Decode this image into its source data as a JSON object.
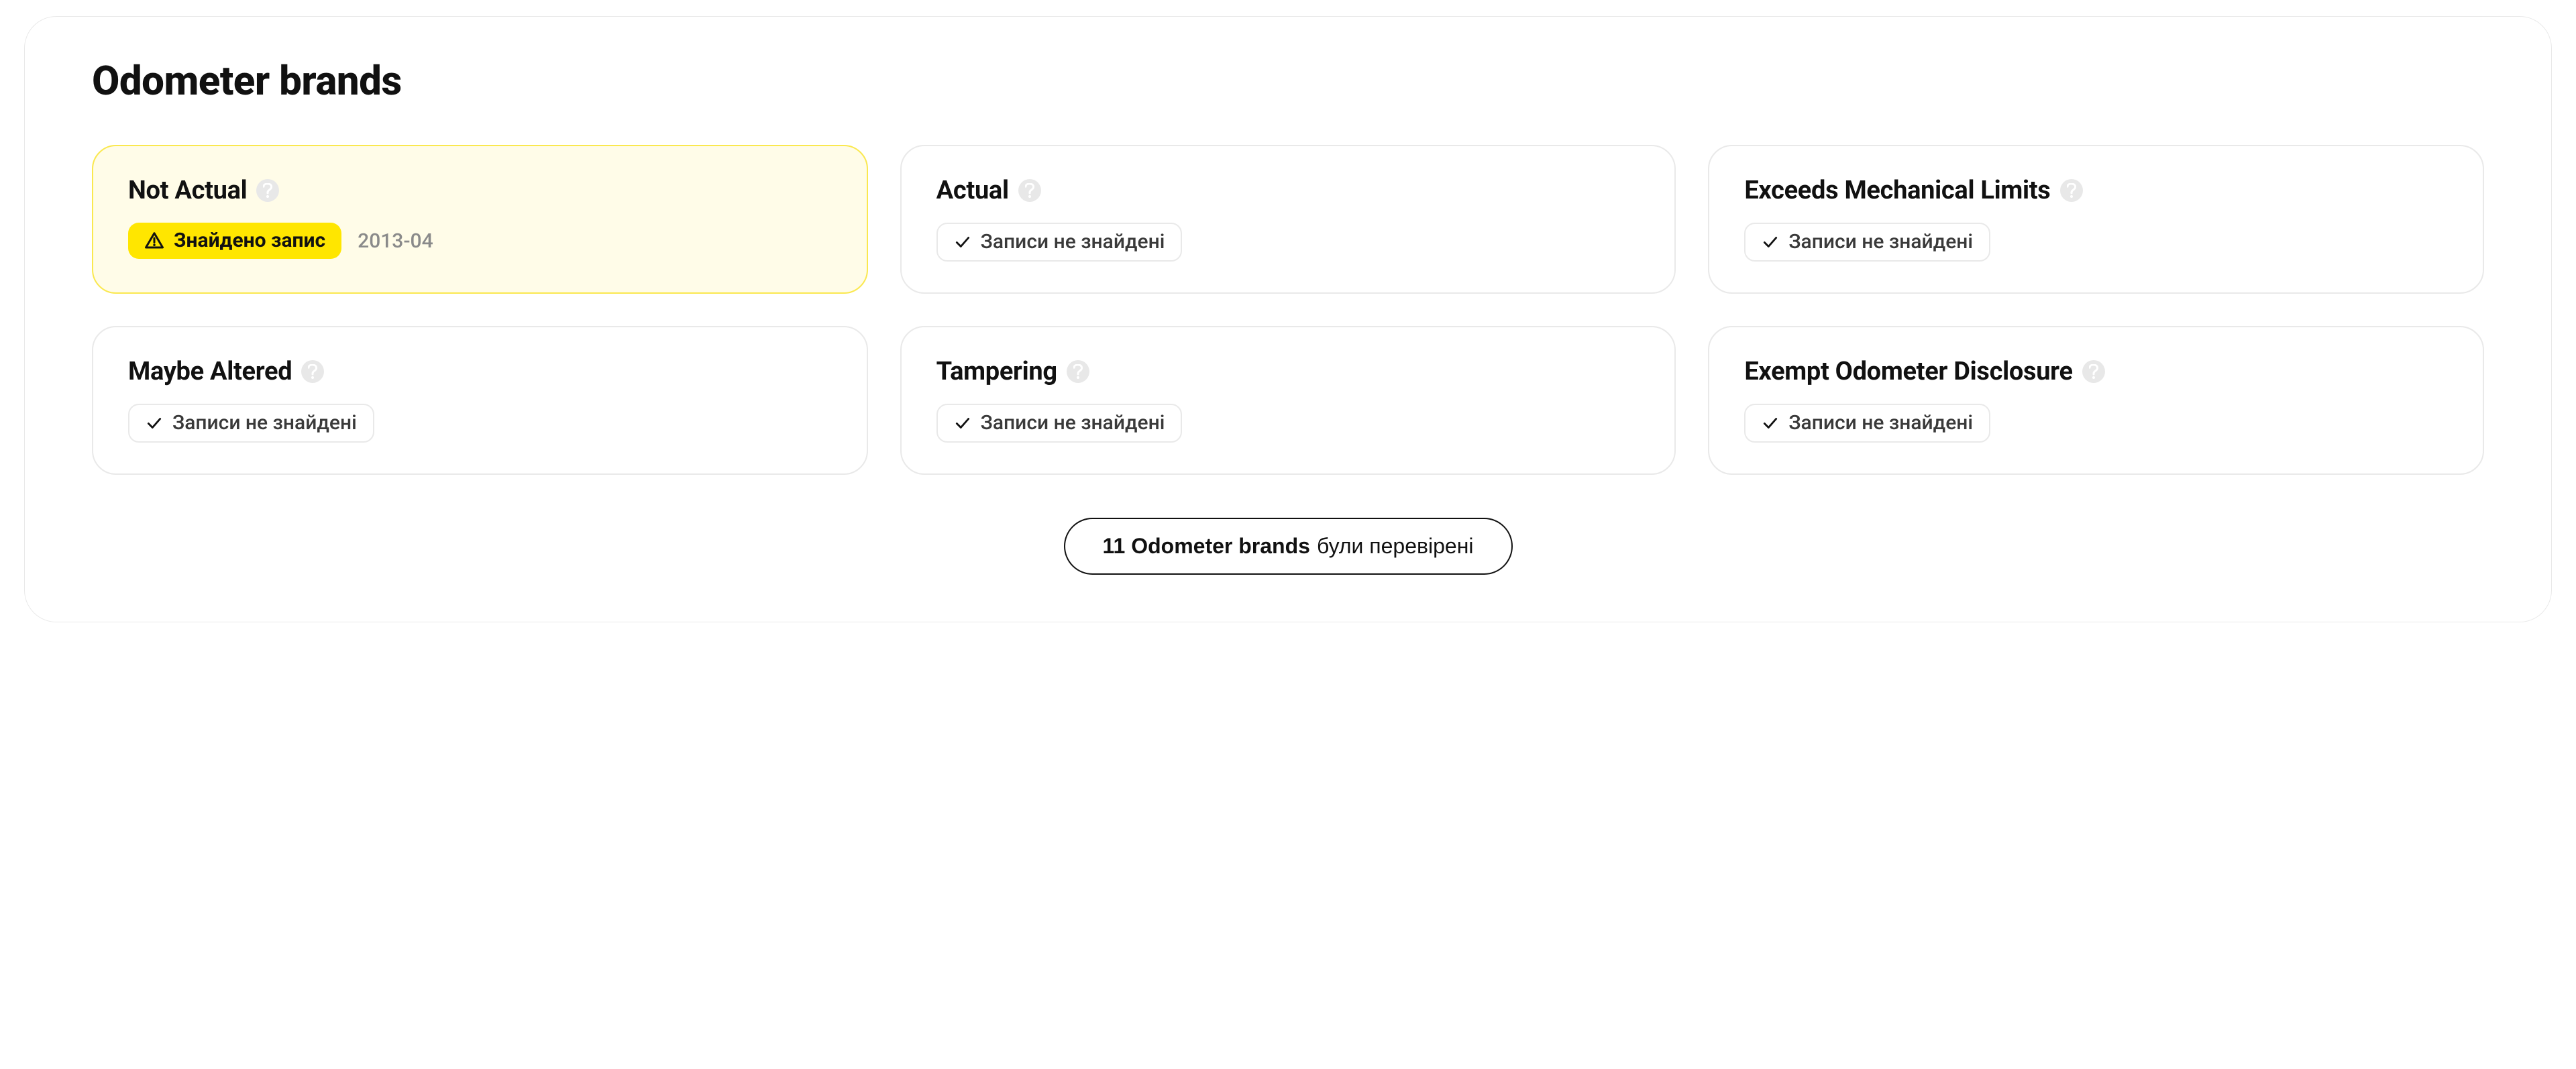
{
  "section": {
    "title": "Odometer brands"
  },
  "cards": [
    {
      "title": "Not Actual",
      "found": true,
      "found_label": "Знайдено запис",
      "date": "2013-04"
    },
    {
      "title": "Actual",
      "found": false,
      "not_found_label": "Записи не знайдені"
    },
    {
      "title": "Exceeds Mechanical Limits",
      "found": false,
      "not_found_label": "Записи не знайдені"
    },
    {
      "title": "Maybe Altered",
      "found": false,
      "not_found_label": "Записи не знайдені"
    },
    {
      "title": "Tampering",
      "found": false,
      "not_found_label": "Записи не знайдені"
    },
    {
      "title": "Exempt Odometer Disclosure",
      "found": false,
      "not_found_label": "Записи не знайдені"
    }
  ],
  "footer": {
    "count_label": "11 Odometer brands",
    "suffix": " були перевірені"
  }
}
